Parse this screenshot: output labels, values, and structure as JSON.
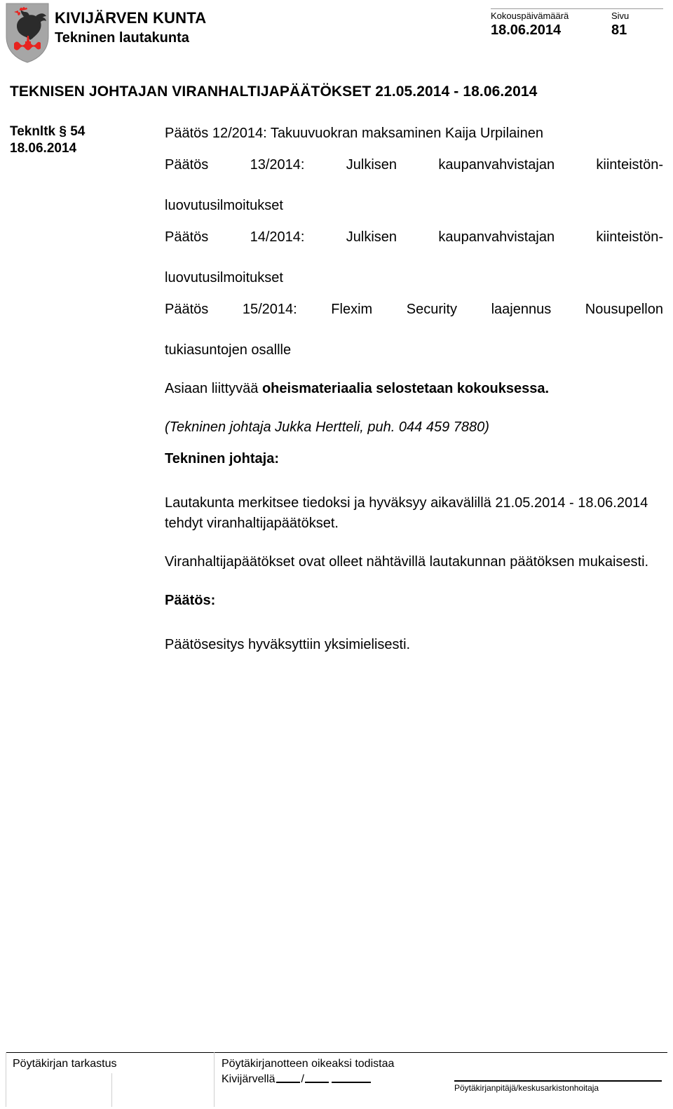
{
  "header": {
    "crest_icon": "kivijarvi-rooster-coat-of-arms",
    "organization": "KIVIJÄRVEN KUNTA",
    "body_name": "Tekninen lautakunta",
    "meeting_date_label": "Kokouspäivämäärä",
    "meeting_date_value": "18.06.2014",
    "page_label": "Sivu",
    "page_value": "81"
  },
  "document": {
    "title": "TEKNISEN JOHTAJAN VIRANHALTIJAPÄÄTÖKSET 21.05.2014 - 18.06.2014"
  },
  "section": {
    "id": "Teknltk § 54",
    "date": "18.06.2014"
  },
  "body": {
    "decision_12": "Päätös 12/2014: Takuuvuokran maksaminen Kaija Urpilainen",
    "decision_13_line1": "Päätös 13/2014: Julkisen kaupanvahvistajan kiinteistön-",
    "decision_13_line2": "luovutusilmoitukset",
    "decision_14_line1": "Päätös 14/2014: Julkisen kaupanvahvistajan kiinteistön-",
    "decision_14_line2": "luovutusilmoitukset",
    "decision_15_line1": "Päätös 15/2014: Flexim Security laajennus Nousupellon",
    "decision_15_line2": "tukiasuntojen osallle",
    "attachment_note_plain": "Asiaan liittyvää ",
    "attachment_note_bold": "oheismateriaalia selostetaan kokouksessa.",
    "contact_italic": "(Tekninen johtaja Jukka Hertteli, puh. 044 459 7880)",
    "proposer_heading": "Tekninen johtaja:",
    "proposal_text": "Lautakunta merkitsee tiedoksi ja hyväksyy aikavälillä 21.05.2014 - 18.06.2014 tehdyt viranhaltijapäätökset.",
    "availability_text": "Viranhaltijapäätökset ovat olleet nähtävillä lautakunnan päätöksen mukaisesti.",
    "decision_heading": "Päätös:",
    "decision_text": "Päätösesitys hyväksyttiin yksimielisesti."
  },
  "footer": {
    "verification_label": "Pöytäkirjan tarkastus",
    "certify_line": "Pöytäkirjanotteen oikeaksi todistaa",
    "place_label": "Kivijärvellä",
    "date_sep": "/",
    "signature_caption": "Pöytäkirjanpitäjä/keskusarkistonhoitaja"
  }
}
